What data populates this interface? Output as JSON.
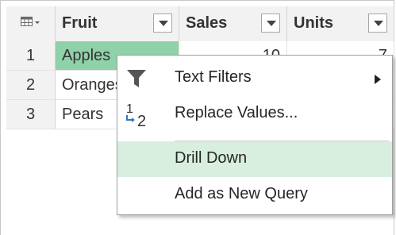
{
  "table": {
    "columns": [
      {
        "label": "Fruit"
      },
      {
        "label": "Sales"
      },
      {
        "label": "Units"
      }
    ],
    "rows": [
      {
        "num": "1",
        "fruit": "Apples",
        "sales": "10",
        "units": "7"
      },
      {
        "num": "2",
        "fruit": "Oranges",
        "sales": "",
        "units": ""
      },
      {
        "num": "3",
        "fruit": "Pears",
        "sales": "",
        "units": ""
      }
    ]
  },
  "menu": {
    "items": [
      {
        "label": "Text Filters",
        "icon": "filter-icon",
        "submenu": true
      },
      {
        "label": "Replace Values...",
        "icon": "replace-values-icon",
        "icon_text_top": "1",
        "icon_text_bottom": "2"
      },
      {
        "label": "Drill Down",
        "highlighted": true
      },
      {
        "label": "Add as New Query"
      }
    ]
  },
  "colors": {
    "selected_cell": "#8fd1a8",
    "menu_hover": "#d8efdf",
    "icon_blue": "#2b79c2"
  }
}
